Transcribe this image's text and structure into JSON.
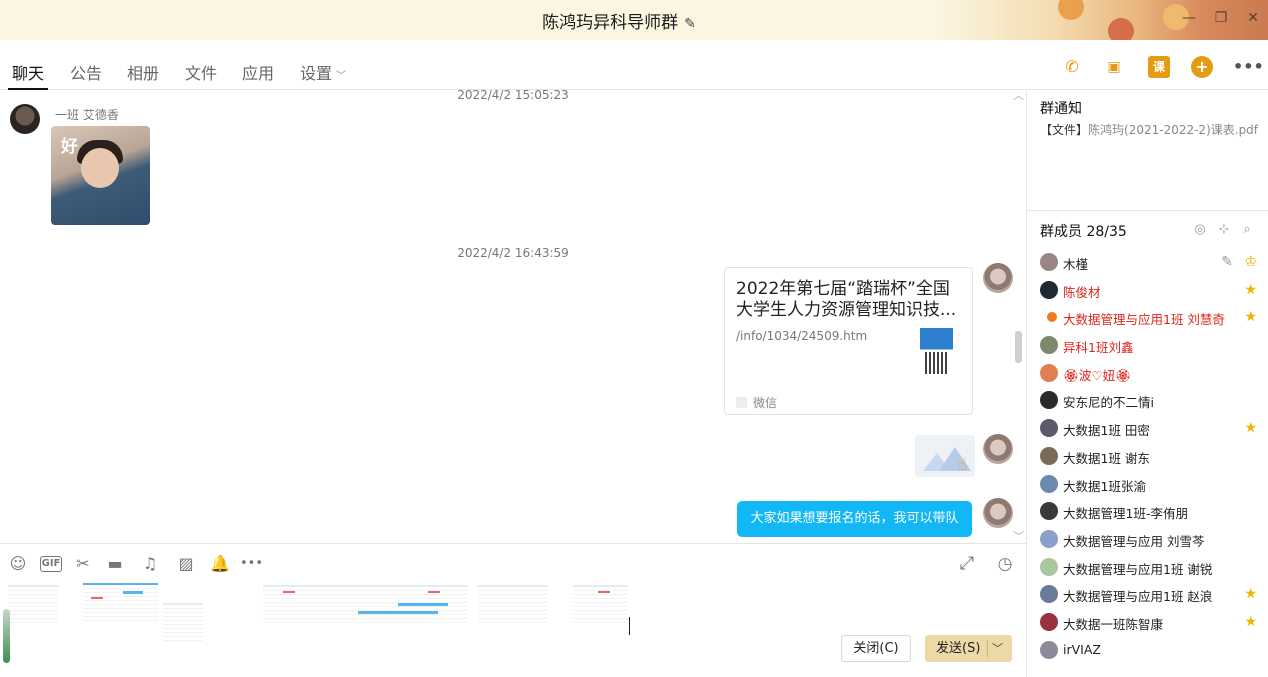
{
  "window": {
    "title": "陈鸿玙异科导师群",
    "controls": [
      "minimize",
      "restore",
      "close"
    ]
  },
  "tabs": [
    {
      "label": "聊天",
      "active": true
    },
    {
      "label": "公告"
    },
    {
      "label": "相册"
    },
    {
      "label": "文件"
    },
    {
      "label": "应用"
    },
    {
      "label": "设置"
    }
  ],
  "toolbar_icons": [
    "phone-icon",
    "video-icon",
    "class-icon",
    "add-icon",
    "more-icon"
  ],
  "toolbar": {
    "class_label": "课"
  },
  "chat": {
    "messages": [
      {
        "timestamp": "2022/4/2 15:05:23",
        "sender": "一班 艾德香",
        "type": "image",
        "image_text": "好"
      },
      {
        "timestamp": "2022/4/2 16:43:59",
        "type": "link-card",
        "card_title": "2022年第七届“踏瑞杯”全国大学生人力资源管理知识技...",
        "card_url": "/info/1034/24509.htm",
        "card_source": "微信"
      },
      {
        "type": "image-placeholder"
      },
      {
        "type": "text",
        "text": "大家如果想要报名的话，我可以带队"
      }
    ]
  },
  "compose": {
    "icons": [
      "emoji-icon",
      "gif-icon",
      "scissors-icon",
      "folder-icon",
      "music-icon",
      "image-icon",
      "bell-icon",
      "more-icon"
    ],
    "gif_label": "GIF",
    "close_button": "关闭(C)",
    "send_button": "发送(S)"
  },
  "notice": {
    "title": "群通知",
    "body_prefix": "【文件】",
    "file_name": "陈鸿玙(2021-2022-2)课表.pdf"
  },
  "members": {
    "title": "群成员 28/35",
    "list": [
      {
        "name": "木槿",
        "color": "normal",
        "badge": "owner"
      },
      {
        "name": "陈俊材",
        "color": "red",
        "badge": "star"
      },
      {
        "name": "大数据管理与应用1班 刘慧奇",
        "color": "red",
        "badge": "star"
      },
      {
        "name": "异科1班刘鑫",
        "color": "red"
      },
      {
        "name": "🏵波♡妞🏵",
        "color": "red"
      },
      {
        "name": "安东尼的不二情i",
        "color": "normal"
      },
      {
        "name": "大数据1班 田密",
        "color": "normal",
        "badge": "star"
      },
      {
        "name": "大数据1班 谢东",
        "color": "normal"
      },
      {
        "name": "大数据1班张渝",
        "color": "normal"
      },
      {
        "name": "大数据管理1班-李侑朋",
        "color": "normal"
      },
      {
        "name": "大数据管理与应用 刘雪芩",
        "color": "normal"
      },
      {
        "name": "大数据管理与应用1班 谢锐",
        "color": "normal"
      },
      {
        "name": "大数据管理与应用1班 赵浪",
        "color": "normal",
        "badge": "star"
      },
      {
        "name": "大数据一班陈智康",
        "color": "normal",
        "badge": "star"
      },
      {
        "name": "irVIAZ",
        "color": "normal"
      }
    ]
  }
}
